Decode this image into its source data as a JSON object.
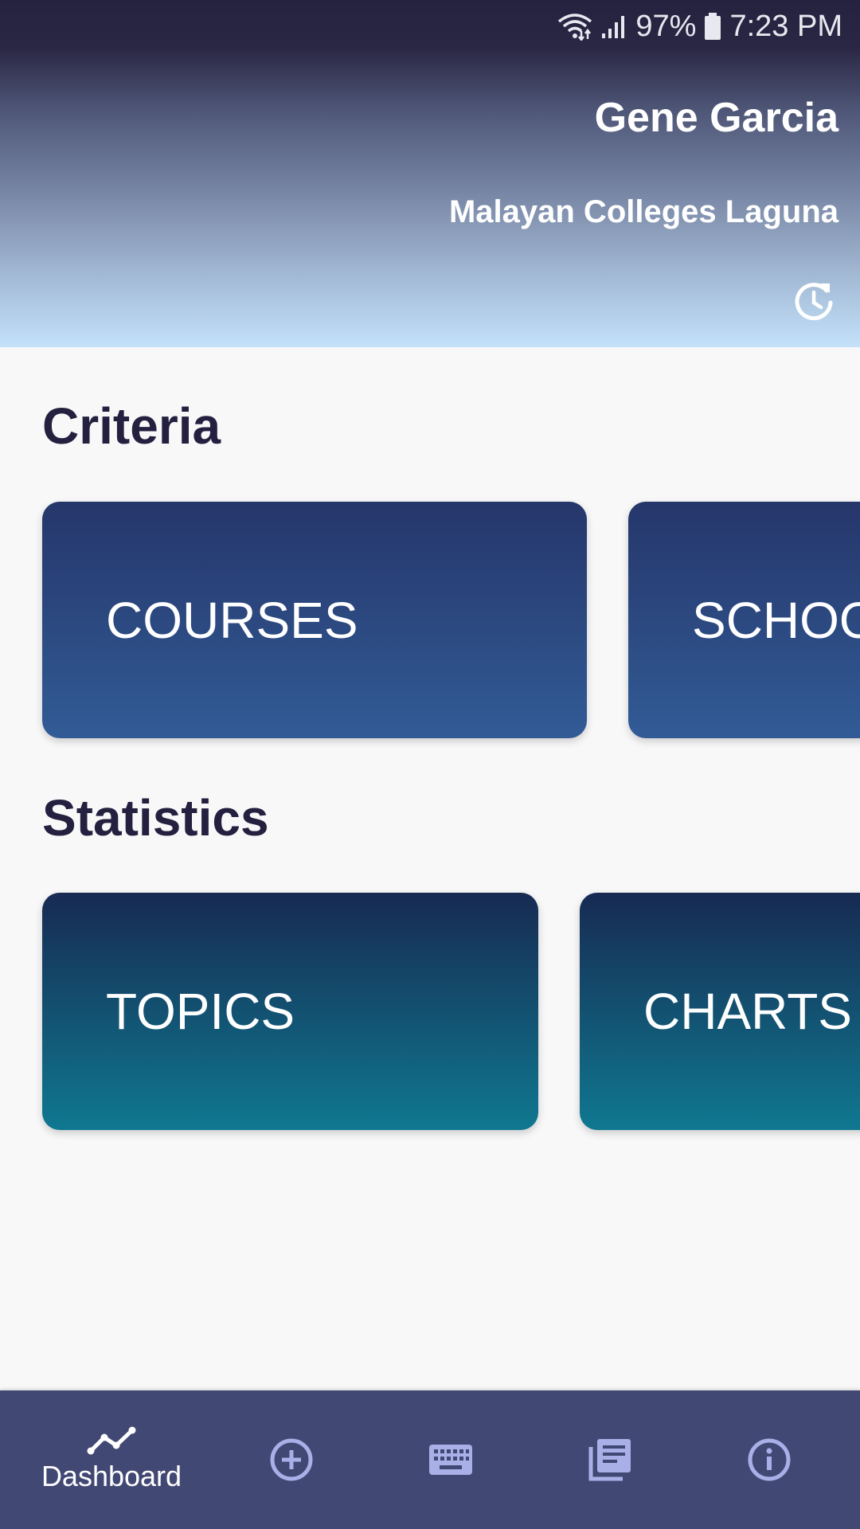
{
  "status_bar": {
    "battery": "97%",
    "time": "7:23 PM"
  },
  "header": {
    "user_name": "Gene Garcia",
    "school": "Malayan Colleges Laguna"
  },
  "criteria": {
    "title": "Criteria",
    "cards": [
      "COURSES",
      "SCHOOLS"
    ]
  },
  "statistics": {
    "title": "Statistics",
    "cards": [
      "TOPICS",
      "CHARTS"
    ]
  },
  "bottom_nav": {
    "dashboard_label": "Dashboard",
    "active": "dashboard",
    "items": [
      "dashboard-icon",
      "add-circle-icon",
      "keyboard-icon",
      "library-books-icon",
      "info-icon"
    ]
  },
  "colors": {
    "nav_background": "#414873",
    "nav_icon": "#a9b0e8",
    "criteria_card_top": "#25366a",
    "criteria_card_bottom": "#325b96",
    "stats_card_top": "#172a52",
    "stats_card_bottom": "#0f7890",
    "text_dark": "#24203f"
  }
}
